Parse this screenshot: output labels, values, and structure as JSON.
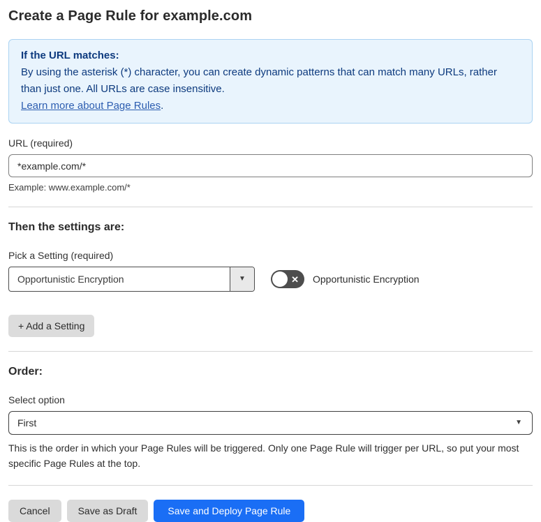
{
  "page": {
    "title": "Create a Page Rule for example.com"
  },
  "info_box": {
    "heading": "If the URL matches:",
    "body": "By using the asterisk (*) character, you can create dynamic patterns that can match many URLs, rather than just one. All URLs are case insensitive.",
    "link_label": "Learn more about Page Rules",
    "link_suffix": "."
  },
  "url_section": {
    "label": "URL (required)",
    "value": "*example.com/*",
    "example": "Example: www.example.com/*"
  },
  "settings_section": {
    "heading": "Then the settings are:",
    "picker_label": "Pick a Setting (required)",
    "picker_value": "Opportunistic Encryption",
    "picker_caret": "▼",
    "toggle_state": "off",
    "toggle_icon": "✕",
    "toggle_label": "Opportunistic Encryption",
    "add_setting_label": "+ Add a Setting"
  },
  "order_section": {
    "heading": "Order:",
    "select_label": "Select option",
    "select_value": "First",
    "select_caret": "▼",
    "help_text": "This is the order in which your Page Rules will be triggered. Only one Page Rule will trigger per URL, so put your most specific Page Rules at the top."
  },
  "footer": {
    "cancel_label": "Cancel",
    "save_draft_label": "Save as Draft",
    "save_deploy_label": "Save and Deploy Page Rule"
  },
  "colors": {
    "accent_blue": "#1a6ef5",
    "info_background": "#e9f4fd",
    "info_border": "#abd3f2",
    "info_text": "#0d3a7e",
    "link_blue": "#2c5db0",
    "toggle_off_background": "#4d4d4d",
    "button_gray": "#dadada"
  }
}
